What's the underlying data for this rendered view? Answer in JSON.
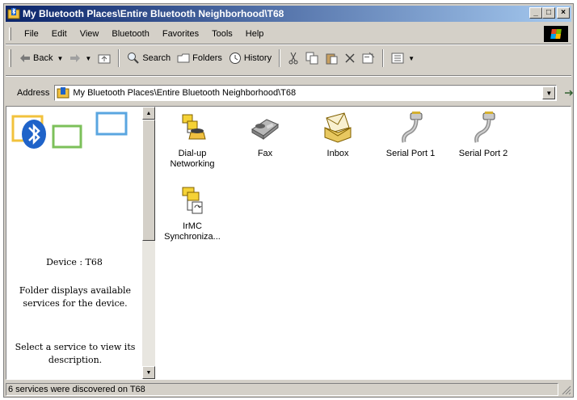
{
  "window": {
    "title": "My Bluetooth Places\\Entire Bluetooth Neighborhood\\T68",
    "minimize": "_",
    "maximize": "□",
    "close": "×"
  },
  "menu": [
    "File",
    "Edit",
    "View",
    "Bluetooth",
    "Favorites",
    "Tools",
    "Help"
  ],
  "toolbar": {
    "back": "Back",
    "search": "Search",
    "folders": "Folders",
    "history": "History"
  },
  "address": {
    "label": "Address",
    "value": "My Bluetooth Places\\Entire Bluetooth Neighborhood\\T68",
    "go": "Go"
  },
  "left_pane": {
    "device": "Device : T68",
    "description": "Folder displays available services for the device.",
    "hint": "Select a service to view its description."
  },
  "services": [
    {
      "label": "Dial-up Networking",
      "icon": "dialup-networking-icon"
    },
    {
      "label": "Fax",
      "icon": "fax-icon"
    },
    {
      "label": "Inbox",
      "icon": "inbox-icon"
    },
    {
      "label": "Serial Port 1",
      "icon": "serial-port-icon"
    },
    {
      "label": "Serial Port 2",
      "icon": "serial-port-icon"
    },
    {
      "label": "IrMC Synchroniza...",
      "icon": "irmc-sync-icon"
    }
  ],
  "status": {
    "text": "6 services were discovered on T68"
  },
  "colors": {
    "titlebar_start": "#0a246a",
    "titlebar_end": "#a6caf0",
    "face": "#d4d0c8",
    "bluetooth": "#1f63c9"
  }
}
